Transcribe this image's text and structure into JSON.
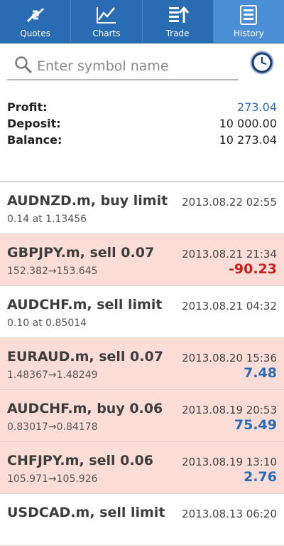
{
  "tabs": [
    {
      "label": "Quotes",
      "icon": "quotes-icon"
    },
    {
      "label": "Charts",
      "icon": "charts-icon"
    },
    {
      "label": "Trade",
      "icon": "trade-icon"
    },
    {
      "label": "History",
      "icon": "history-icon",
      "active": true
    }
  ],
  "search": {
    "placeholder": "Enter symbol name",
    "value": ""
  },
  "summary": {
    "profit_label": "Profit:",
    "profit_value": "273.04",
    "deposit_label": "Deposit:",
    "deposit_value": "10 000.00",
    "balance_label": "Balance:",
    "balance_value": "10 273.04"
  },
  "trades": [
    {
      "title": "AUDNZD.m, buy limit",
      "time": "2013.08.22 02:55",
      "detail": "0.14 at 1.13456",
      "profit": ""
    },
    {
      "title": "GBPJPY.m, sell 0.07",
      "time": "2013.08.21 21:34",
      "detail": "152.382→153.645",
      "profit": "-90.23"
    },
    {
      "title": "AUDCHF.m, sell limit",
      "time": "2013.08.21 04:32",
      "detail": "0.10 at 0.85014",
      "profit": ""
    },
    {
      "title": "EURAUD.m, sell 0.07",
      "time": "2013.08.20 15:36",
      "detail": "1.48367→1.48249",
      "profit": "7.48"
    },
    {
      "title": "AUDCHF.m, buy 0.06",
      "time": "2013.08.19 20:53",
      "detail": "0.83017→0.84178",
      "profit": "75.49"
    },
    {
      "title": "CHFJPY.m, sell 0.06",
      "time": "2013.08.19 13:10",
      "detail": "105.971→105.926",
      "profit": "2.76"
    },
    {
      "title": "USDCAD.m, sell limit",
      "time": "2013.08.13 06:20",
      "detail": "",
      "profit": ""
    }
  ],
  "colors": {
    "accent": "#2a6cb4",
    "loss": "#c62020",
    "row_tint": "#fcdcd6"
  }
}
